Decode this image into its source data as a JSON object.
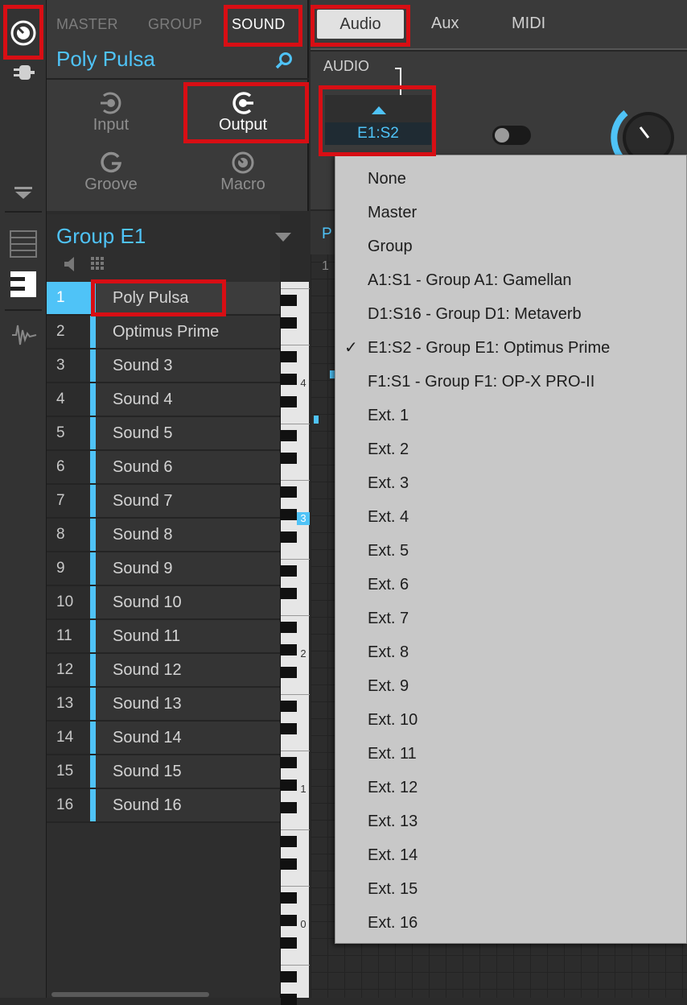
{
  "header": {
    "tabs": [
      "MASTER",
      "GROUP",
      "SOUND"
    ],
    "active_tab": "SOUND",
    "sound_name": "Poly Pulsa"
  },
  "pages": [
    {
      "label": "Input",
      "icon": "input-icon"
    },
    {
      "label": "Output",
      "icon": "output-icon"
    },
    {
      "label": "Groove",
      "icon": "groove-icon"
    },
    {
      "label": "Macro",
      "icon": "macro-icon"
    }
  ],
  "selected_page": "Output",
  "group": {
    "title": "Group E1",
    "sounds": [
      {
        "num": "1",
        "name": "Poly Pulsa",
        "selected": true
      },
      {
        "num": "2",
        "name": "Optimus Prime"
      },
      {
        "num": "3",
        "name": "Sound 3"
      },
      {
        "num": "4",
        "name": "Sound 4"
      },
      {
        "num": "5",
        "name": "Sound 5"
      },
      {
        "num": "6",
        "name": "Sound 6"
      },
      {
        "num": "7",
        "name": "Sound 7"
      },
      {
        "num": "8",
        "name": "Sound 8"
      },
      {
        "num": "9",
        "name": "Sound 9"
      },
      {
        "num": "10",
        "name": "Sound 10"
      },
      {
        "num": "11",
        "name": "Sound 11"
      },
      {
        "num": "12",
        "name": "Sound 12"
      },
      {
        "num": "13",
        "name": "Sound 13"
      },
      {
        "num": "14",
        "name": "Sound 14"
      },
      {
        "num": "15",
        "name": "Sound 15"
      },
      {
        "num": "16",
        "name": "Sound 16"
      }
    ]
  },
  "keyboard": {
    "octave_labels": [
      "4",
      "3",
      "2",
      "1",
      "0"
    ]
  },
  "right": {
    "tabs": [
      "Audio",
      "Aux",
      "MIDI"
    ],
    "active_tab": "Audio",
    "section_label": "AUDIO",
    "destination_value": "E1:S2",
    "grid_partial_label": "P",
    "grid_partial_num": "1"
  },
  "dropdown": {
    "options": [
      "None",
      "Master",
      "Group",
      "A1:S1 - Group A1: Gamellan",
      "D1:S16 - Group D1: Metaverb",
      "E1:S2 - Group E1: Optimus Prime",
      "F1:S1 - Group F1: OP-X PRO-II",
      "Ext. 1",
      "Ext. 2",
      "Ext. 3",
      "Ext. 4",
      "Ext. 5",
      "Ext. 6",
      "Ext. 7",
      "Ext. 8",
      "Ext. 9",
      "Ext. 10",
      "Ext. 11",
      "Ext. 12",
      "Ext. 13",
      "Ext. 14",
      "Ext. 15",
      "Ext. 16"
    ],
    "checked": "E1:S2 - Group E1: Optimus Prime"
  },
  "colors": {
    "accent": "#4fc3f7",
    "highlight": "#d80e14",
    "dropdown_bg": "#c8c8c8"
  }
}
